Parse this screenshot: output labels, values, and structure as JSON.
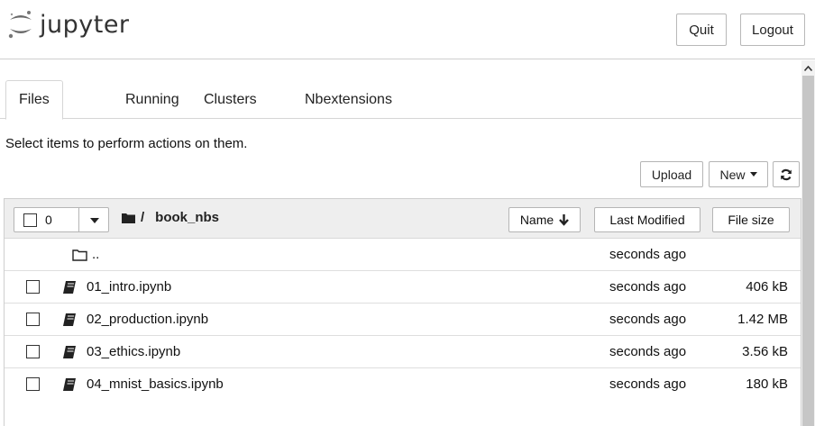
{
  "header": {
    "logo_text": "jupyter",
    "quit_label": "Quit",
    "logout_label": "Logout"
  },
  "tabs": [
    {
      "label": "Files",
      "active": true
    },
    {
      "label": "Running",
      "active": false
    },
    {
      "label": "Clusters",
      "active": false
    },
    {
      "label": "Nbextensions",
      "active": false
    }
  ],
  "hint": "Select items to perform actions on them.",
  "toolbar": {
    "upload_label": "Upload",
    "new_label": "New",
    "refresh_icon": "refresh-icon"
  },
  "list_header": {
    "selected_count": "0",
    "breadcrumb_sep": "/",
    "folder": "book_nbs",
    "sort_name_label": "Name",
    "sort_modified_label": "Last Modified",
    "sort_size_label": "File size"
  },
  "rows": [
    {
      "type": "parent",
      "name": "..",
      "modified": "seconds ago",
      "size": ""
    },
    {
      "type": "notebook",
      "name": "01_intro.ipynb",
      "modified": "seconds ago",
      "size": "406 kB"
    },
    {
      "type": "notebook",
      "name": "02_production.ipynb",
      "modified": "seconds ago",
      "size": "1.42 MB"
    },
    {
      "type": "notebook",
      "name": "03_ethics.ipynb",
      "modified": "seconds ago",
      "size": "3.56 kB"
    },
    {
      "type": "notebook",
      "name": "04_mnist_basics.ipynb",
      "modified": "seconds ago",
      "size": "180 kB"
    }
  ],
  "colors": {
    "header_border": "#cfcfcf",
    "list_header_bg": "#eeeeee",
    "scroll_thumb": "#c6c6c6"
  }
}
